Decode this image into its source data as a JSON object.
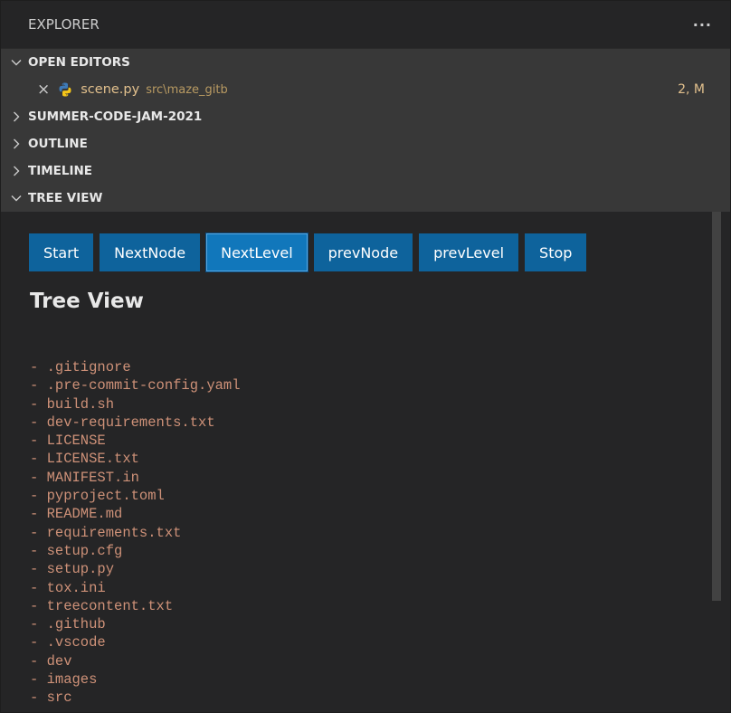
{
  "explorer": {
    "title": "EXPLORER",
    "more_label": "···"
  },
  "sections": {
    "open_editors": "OPEN EDITORS",
    "summer_code_jam": "SUMMER-CODE-JAM-2021",
    "outline": "OUTLINE",
    "timeline": "TIMELINE",
    "tree_view": "TREE VIEW"
  },
  "open_editor": {
    "close_glyph": "×",
    "file_name": "scene.py",
    "file_path": "src\\maze_gitb",
    "status": "2, M"
  },
  "buttons": [
    {
      "label": "Start"
    },
    {
      "label": "NextNode"
    },
    {
      "label": "NextLevel"
    },
    {
      "label": "prevNode"
    },
    {
      "label": "prevLevel"
    },
    {
      "label": "Stop"
    }
  ],
  "tree": {
    "title": "Tree View",
    "items": [
      "- .gitignore",
      "- .pre-commit-config.yaml",
      "- build.sh",
      "- dev-requirements.txt",
      "- LICENSE",
      "- LICENSE.txt",
      "- MANIFEST.in",
      "- pyproject.toml",
      "- README.md",
      "- requirements.txt",
      "- setup.cfg",
      "- setup.py",
      "- tox.ini",
      "- treecontent.txt",
      "- .github",
      "- .vscode",
      "- dev",
      "- images",
      "- src"
    ]
  },
  "colors": {
    "accent_button": "#0e639c",
    "modified_file": "#e2c08d",
    "tree_text": "#ce9178"
  },
  "icons": {
    "more": "ellipsis-icon",
    "expanded": "chevron-down-icon",
    "collapsed": "chevron-right-icon",
    "close": "close-icon",
    "python": "python-icon"
  }
}
